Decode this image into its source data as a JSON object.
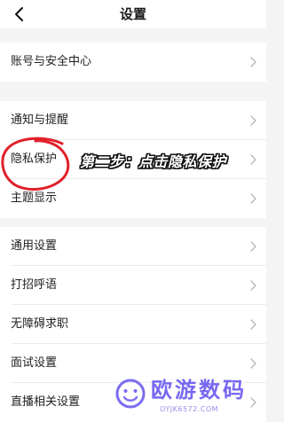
{
  "header": {
    "title": "设置",
    "back_icon": "chevron-left-icon"
  },
  "settings": {
    "items": [
      {
        "label": "账号与安全中心"
      },
      {
        "label": "通知与提醒"
      },
      {
        "label": "隐私保护"
      },
      {
        "label": "主题显示"
      },
      {
        "label": "通用设置"
      },
      {
        "label": "打招呼语"
      },
      {
        "label": "无障碍求职"
      },
      {
        "label": "面试设置"
      },
      {
        "label": "直播相关设置"
      }
    ],
    "row_icon": "chevron-right-icon"
  },
  "annotation": {
    "text": "第二步：点击隐私保护",
    "circle_color": "#e0202a"
  },
  "watermark": {
    "title": "欧游数码",
    "subtitle": "OYJK6572.COM",
    "color": "#6d5cf0"
  }
}
